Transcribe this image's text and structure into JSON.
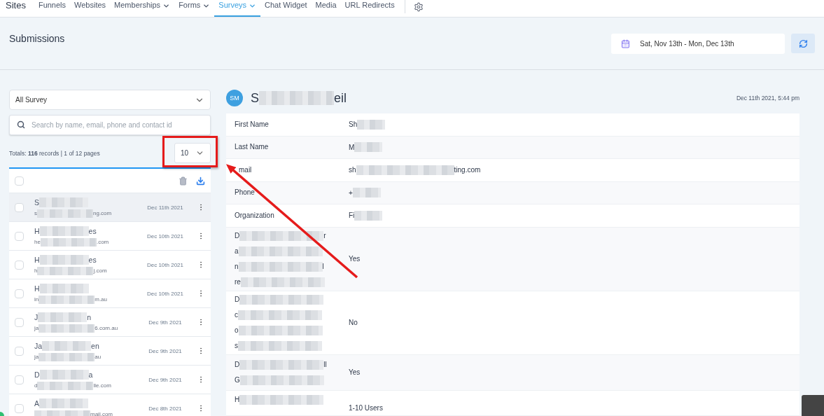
{
  "nav": {
    "brand": "Sites",
    "items": [
      {
        "label": "Funnels",
        "dropdown": false,
        "selected": false
      },
      {
        "label": "Websites",
        "dropdown": false,
        "selected": false
      },
      {
        "label": "Memberships",
        "dropdown": true,
        "selected": false
      },
      {
        "label": "Forms",
        "dropdown": true,
        "selected": false
      },
      {
        "label": "Surveys",
        "dropdown": true,
        "selected": true
      },
      {
        "label": "Chat Widget",
        "dropdown": false,
        "selected": false
      },
      {
        "label": "Media",
        "dropdown": false,
        "selected": false
      },
      {
        "label": "URL Redirects",
        "dropdown": false,
        "selected": false
      }
    ]
  },
  "header": {
    "title": "Submissions",
    "date_range": "Sat, Nov 13th - Mon, Dec 13th"
  },
  "filters": {
    "survey": "All Survey",
    "search_placeholder": "Search by name, email, phone and contact id",
    "totals": "Totals: **116** records | 1 of 12 pages",
    "page_size": "10"
  },
  "select_all_checked": false,
  "submissions": [
    {
      "name": {
        "start": "S"
      },
      "email": {
        "start": "s",
        "end": "ng.com"
      },
      "date": "Dec 11th 2021",
      "selected": true,
      "checked": false
    },
    {
      "name": {
        "start": "H",
        "end": "es"
      },
      "email": {
        "start": "he",
        "end": ".com"
      },
      "date": "Dec 10th 2021",
      "selected": false,
      "checked": false
    },
    {
      "name": {
        "start": "H",
        "end": "es"
      },
      "email": {
        "start": "h",
        "end": "j.com"
      },
      "date": "Dec 10th 2021",
      "selected": false,
      "checked": false
    },
    {
      "name": {
        "start": "H"
      },
      "email": {
        "start": "in",
        "end": "m.au"
      },
      "date": "Dec 10th 2021",
      "selected": false,
      "checked": false
    },
    {
      "name": {
        "start": "J",
        "end": "n"
      },
      "email": {
        "start": "ja",
        "end": "6.com.au"
      },
      "date": "Dec 9th 2021",
      "selected": false,
      "checked": false
    },
    {
      "name": {
        "start": "Ja",
        "end": "en"
      },
      "email": {
        "start": "ja",
        "end": "au"
      },
      "date": "Dec 9th 2021",
      "selected": false,
      "checked": false
    },
    {
      "name": {
        "start": "D",
        "end": "a"
      },
      "email": {
        "start": "d",
        "end": "lle.com"
      },
      "date": "Dec 9th 2021",
      "selected": false,
      "checked": false
    },
    {
      "name": {
        "start": "A"
      },
      "email": {
        "end": "mail.com"
      },
      "date": "Dec 8th 2021",
      "selected": false,
      "checked": false
    }
  ],
  "detail": {
    "avatar": "SM",
    "name": {
      "start": "S",
      "end": "eil"
    },
    "submitted": "Dec 11th 2021, 5:44 pm",
    "fields": [
      {
        "kind": "plain",
        "label": [
          {
            "start": "First Name"
          }
        ],
        "value": {
          "start": "Sh"
        }
      },
      {
        "kind": "plain",
        "label": [
          {
            "start": "Last Name"
          }
        ],
        "value": {
          "start": "M"
        }
      },
      {
        "kind": "plain",
        "label": [
          {
            "start": "mail"
          }
        ],
        "value": {
          "start": "sh",
          "end": "ting.com"
        }
      },
      {
        "kind": "plain",
        "label": [
          {
            "start": "Phone"
          }
        ],
        "value": {
          "start": "+"
        }
      },
      {
        "kind": "plain",
        "label": [
          {
            "start": "Organization"
          }
        ],
        "value": {
          "start": "Fi"
        }
      },
      {
        "kind": "redacted",
        "label": [
          {
            "start": "D",
            "end": "r"
          },
          {
            "start": "a"
          },
          {
            "start": "n",
            "end": "l"
          },
          {
            "start": "re"
          }
        ],
        "value": {
          "start": "Yes"
        }
      },
      {
        "kind": "redacted",
        "label": [
          {
            "start": "D"
          },
          {
            "start": "c"
          },
          {
            "start": "o"
          },
          {
            "start": "s"
          }
        ],
        "value": {
          "start": "No"
        }
      },
      {
        "kind": "redacted",
        "label": [
          {
            "start": "D",
            "end": "ll"
          },
          {
            "start": "G"
          }
        ],
        "value": {
          "start": "Yes"
        }
      },
      {
        "kind": "redacted",
        "label": [
          {
            "start": "H"
          }
        ],
        "value": {
          "start": "1-10 Users"
        }
      }
    ]
  }
}
